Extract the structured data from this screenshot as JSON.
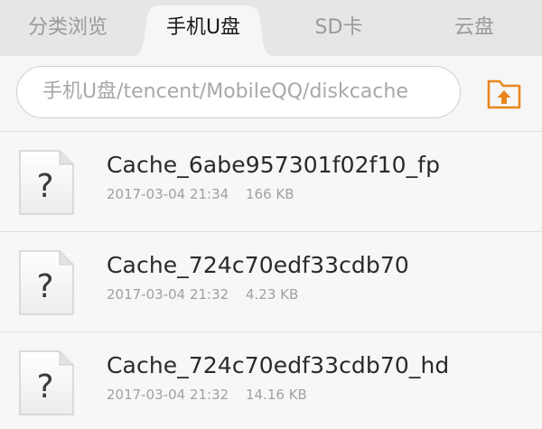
{
  "tabs": [
    {
      "label": "分类浏览"
    },
    {
      "label": "手机U盘",
      "active": true
    },
    {
      "label": "SD卡"
    },
    {
      "label": "云盘"
    }
  ],
  "path": {
    "value": "手机U盘/tencent/MobileQQ/diskcache"
  },
  "up_button": {
    "icon": "folder-up-icon",
    "color": "#e8861e"
  },
  "files": [
    {
      "name": "Cache_6abe957301f02f10_fp",
      "date": "2017-03-04 21:34",
      "size": "166 KB",
      "icon": "unknown-file-icon"
    },
    {
      "name": "Cache_724c70edf33cdb70",
      "date": "2017-03-04 21:32",
      "size": "4.23 KB",
      "icon": "unknown-file-icon"
    },
    {
      "name": "Cache_724c70edf33cdb70_hd",
      "date": "2017-03-04 21:32",
      "size": "14.16 KB",
      "icon": "unknown-file-icon"
    }
  ],
  "colors": {
    "accent": "#e8861e",
    "tab_bar": "#e6e6e6",
    "active_tab": "#f6f6f6"
  }
}
